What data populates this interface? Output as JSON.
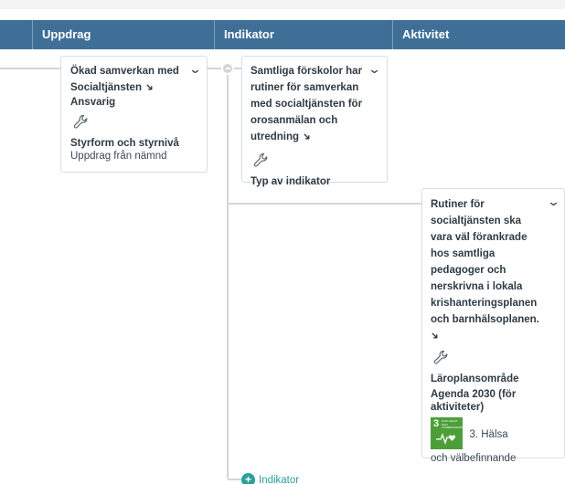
{
  "columns": {
    "uppdrag": "Uppdrag",
    "indikator": "Indikator",
    "aktivitet": "Aktivitet"
  },
  "uppdrag_card": {
    "title": "Ökad samverkan med Socialtjänsten",
    "responsible_label": "Ansvarig",
    "styrform_label": "Styrform och styrnivå",
    "styrform_value": "Uppdrag från nämnd"
  },
  "indikator_card": {
    "title": "Samtliga förskolor har rutiner för samverkan med socialtjänsten för orosanmälan och utredning",
    "type_label": "Typ av indikator"
  },
  "aktivitet_card": {
    "title": "Rutiner för socialtjänsten ska vara väl förankrade hos samtliga pedagoger och nerskrivna i lokala krishanteringsplanen och barnhälsoplanen.",
    "lpo_label": "Läroplansområde",
    "agenda_label": "Agenda 2030 (för aktiviteter)",
    "sdg_number": "3",
    "sdg_badge_text": "GOD HÄLSA OCH VÄLBEFINNANDE",
    "sdg_goal_text": "3. Hälsa",
    "sdg_goal_text_cont": "och välbefinnande",
    "sdg_color": "#4c9f38"
  },
  "add_indikator": {
    "label": "Indikator"
  },
  "icons": {
    "chevron": "chevron-down-icon",
    "pin": "pin-icon",
    "wrench": "wrench-icon",
    "collapse": "collapse-node-icon",
    "add": "plus-circle-icon"
  },
  "accent_colors": {
    "header": "#3f6f96",
    "add": "#2aa198"
  }
}
